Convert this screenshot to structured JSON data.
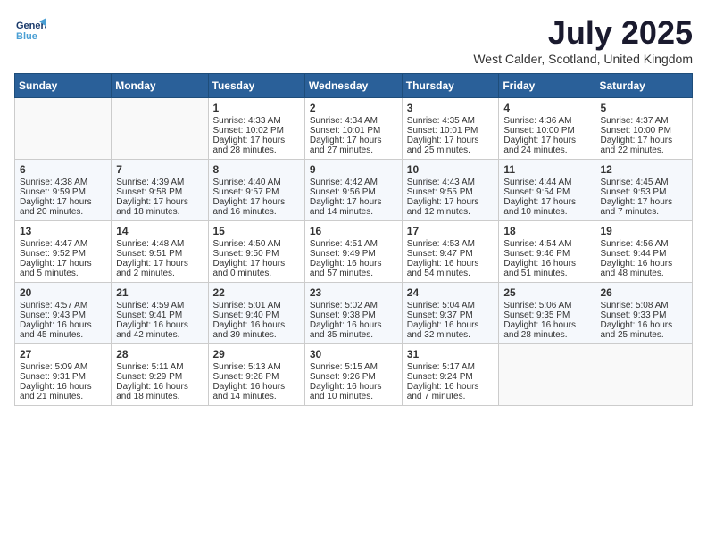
{
  "header": {
    "logo_line1": "General",
    "logo_line2": "Blue",
    "title": "July 2025",
    "location": "West Calder, Scotland, United Kingdom"
  },
  "days_of_week": [
    "Sunday",
    "Monday",
    "Tuesday",
    "Wednesday",
    "Thursday",
    "Friday",
    "Saturday"
  ],
  "weeks": [
    [
      {
        "day": "",
        "info": ""
      },
      {
        "day": "",
        "info": ""
      },
      {
        "day": "1",
        "info": "Sunrise: 4:33 AM\nSunset: 10:02 PM\nDaylight: 17 hours and 28 minutes."
      },
      {
        "day": "2",
        "info": "Sunrise: 4:34 AM\nSunset: 10:01 PM\nDaylight: 17 hours and 27 minutes."
      },
      {
        "day": "3",
        "info": "Sunrise: 4:35 AM\nSunset: 10:01 PM\nDaylight: 17 hours and 25 minutes."
      },
      {
        "day": "4",
        "info": "Sunrise: 4:36 AM\nSunset: 10:00 PM\nDaylight: 17 hours and 24 minutes."
      },
      {
        "day": "5",
        "info": "Sunrise: 4:37 AM\nSunset: 10:00 PM\nDaylight: 17 hours and 22 minutes."
      }
    ],
    [
      {
        "day": "6",
        "info": "Sunrise: 4:38 AM\nSunset: 9:59 PM\nDaylight: 17 hours and 20 minutes."
      },
      {
        "day": "7",
        "info": "Sunrise: 4:39 AM\nSunset: 9:58 PM\nDaylight: 17 hours and 18 minutes."
      },
      {
        "day": "8",
        "info": "Sunrise: 4:40 AM\nSunset: 9:57 PM\nDaylight: 17 hours and 16 minutes."
      },
      {
        "day": "9",
        "info": "Sunrise: 4:42 AM\nSunset: 9:56 PM\nDaylight: 17 hours and 14 minutes."
      },
      {
        "day": "10",
        "info": "Sunrise: 4:43 AM\nSunset: 9:55 PM\nDaylight: 17 hours and 12 minutes."
      },
      {
        "day": "11",
        "info": "Sunrise: 4:44 AM\nSunset: 9:54 PM\nDaylight: 17 hours and 10 minutes."
      },
      {
        "day": "12",
        "info": "Sunrise: 4:45 AM\nSunset: 9:53 PM\nDaylight: 17 hours and 7 minutes."
      }
    ],
    [
      {
        "day": "13",
        "info": "Sunrise: 4:47 AM\nSunset: 9:52 PM\nDaylight: 17 hours and 5 minutes."
      },
      {
        "day": "14",
        "info": "Sunrise: 4:48 AM\nSunset: 9:51 PM\nDaylight: 17 hours and 2 minutes."
      },
      {
        "day": "15",
        "info": "Sunrise: 4:50 AM\nSunset: 9:50 PM\nDaylight: 17 hours and 0 minutes."
      },
      {
        "day": "16",
        "info": "Sunrise: 4:51 AM\nSunset: 9:49 PM\nDaylight: 16 hours and 57 minutes."
      },
      {
        "day": "17",
        "info": "Sunrise: 4:53 AM\nSunset: 9:47 PM\nDaylight: 16 hours and 54 minutes."
      },
      {
        "day": "18",
        "info": "Sunrise: 4:54 AM\nSunset: 9:46 PM\nDaylight: 16 hours and 51 minutes."
      },
      {
        "day": "19",
        "info": "Sunrise: 4:56 AM\nSunset: 9:44 PM\nDaylight: 16 hours and 48 minutes."
      }
    ],
    [
      {
        "day": "20",
        "info": "Sunrise: 4:57 AM\nSunset: 9:43 PM\nDaylight: 16 hours and 45 minutes."
      },
      {
        "day": "21",
        "info": "Sunrise: 4:59 AM\nSunset: 9:41 PM\nDaylight: 16 hours and 42 minutes."
      },
      {
        "day": "22",
        "info": "Sunrise: 5:01 AM\nSunset: 9:40 PM\nDaylight: 16 hours and 39 minutes."
      },
      {
        "day": "23",
        "info": "Sunrise: 5:02 AM\nSunset: 9:38 PM\nDaylight: 16 hours and 35 minutes."
      },
      {
        "day": "24",
        "info": "Sunrise: 5:04 AM\nSunset: 9:37 PM\nDaylight: 16 hours and 32 minutes."
      },
      {
        "day": "25",
        "info": "Sunrise: 5:06 AM\nSunset: 9:35 PM\nDaylight: 16 hours and 28 minutes."
      },
      {
        "day": "26",
        "info": "Sunrise: 5:08 AM\nSunset: 9:33 PM\nDaylight: 16 hours and 25 minutes."
      }
    ],
    [
      {
        "day": "27",
        "info": "Sunrise: 5:09 AM\nSunset: 9:31 PM\nDaylight: 16 hours and 21 minutes."
      },
      {
        "day": "28",
        "info": "Sunrise: 5:11 AM\nSunset: 9:29 PM\nDaylight: 16 hours and 18 minutes."
      },
      {
        "day": "29",
        "info": "Sunrise: 5:13 AM\nSunset: 9:28 PM\nDaylight: 16 hours and 14 minutes."
      },
      {
        "day": "30",
        "info": "Sunrise: 5:15 AM\nSunset: 9:26 PM\nDaylight: 16 hours and 10 minutes."
      },
      {
        "day": "31",
        "info": "Sunrise: 5:17 AM\nSunset: 9:24 PM\nDaylight: 16 hours and 7 minutes."
      },
      {
        "day": "",
        "info": ""
      },
      {
        "day": "",
        "info": ""
      }
    ]
  ]
}
